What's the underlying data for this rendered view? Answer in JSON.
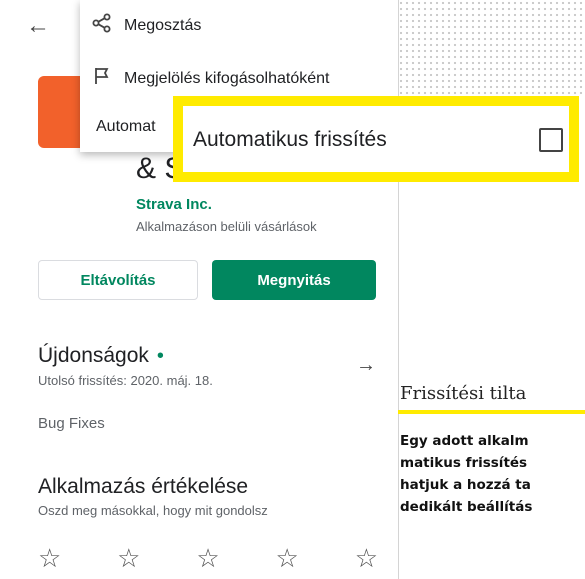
{
  "phone": {
    "back_icon": "arrow-left-icon",
    "app": {
      "title_fragment": "& S",
      "developer": "Strava Inc.",
      "subtitle": "Alkalmazáson belüli vásárlások"
    },
    "buttons": {
      "uninstall": "Eltávolítás",
      "open": "Megnyitás"
    },
    "news": {
      "title": "Újdonságok",
      "dot": "•",
      "date": "Utolsó frissítés: 2020. máj. 18.",
      "body": "Bug Fixes"
    },
    "rating": {
      "title": "Alkalmazás értékelése",
      "subtitle": "Oszd meg másokkal, hogy mit gondolsz",
      "stars": [
        "☆",
        "☆",
        "☆",
        "☆",
        "☆"
      ]
    },
    "menu": {
      "items": [
        {
          "icon": "share-icon",
          "glyph": "<",
          "label": "Megosztás"
        },
        {
          "icon": "flag-icon",
          "glyph": "⚐",
          "label": "Megjelölés kifogásolhatóként"
        },
        {
          "icon": "",
          "glyph": "",
          "label": "Automat"
        }
      ]
    }
  },
  "callout": {
    "label": "Automatikus frissítés",
    "checked": false
  },
  "article": {
    "heading": "Frissítési tilta",
    "lines": [
      "Egy adott alkalm",
      "matikus frissítés",
      "hatjuk a hozzá ta",
      "dedikált beállítás"
    ]
  },
  "colors": {
    "highlight": "#ffeb00",
    "play_green": "#01875f",
    "app_orange": "#f2612b"
  }
}
